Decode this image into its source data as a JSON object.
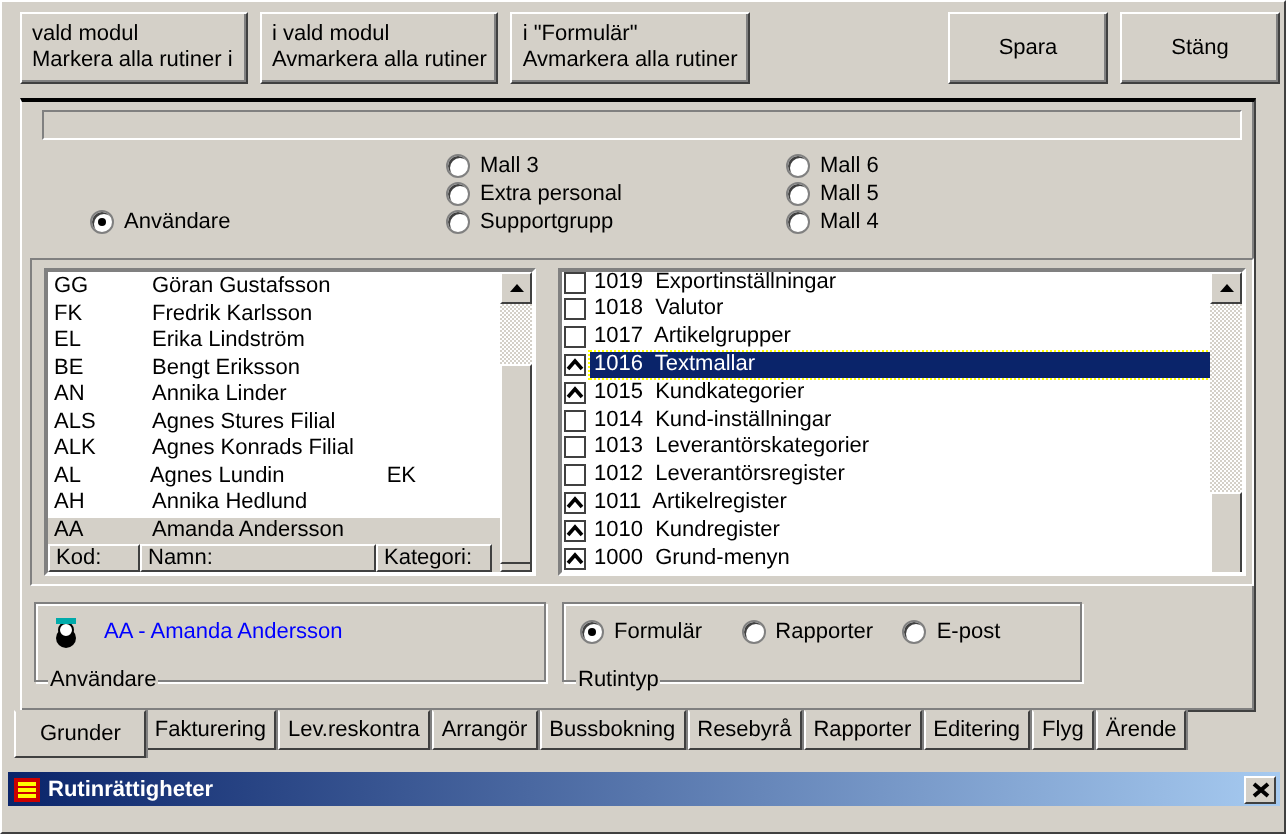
{
  "buttons": [
    {
      "lines": [
        "vald modul",
        "Markera alla rutiner i"
      ],
      "kind": "wide"
    },
    {
      "lines": [
        "i vald modul",
        "Avmarkera alla rutiner"
      ],
      "kind": "wide"
    },
    {
      "lines": [
        "i \"Formulär\"",
        "Avmarkera alla rutiner"
      ],
      "kind": "wide"
    },
    {
      "lines": [
        "Spara"
      ],
      "kind": "small"
    },
    {
      "lines": [
        "Stäng"
      ],
      "kind": "small"
    }
  ],
  "owner_options": [
    {
      "label": "Mall 3",
      "selected": false
    },
    {
      "label": "Mall 6",
      "selected": false
    },
    {
      "label": "Extra personal",
      "selected": false
    },
    {
      "label": "Mall 5",
      "selected": false
    },
    {
      "label": "Användare",
      "selected": true
    },
    {
      "label": "Supportgrupp",
      "selected": false
    },
    {
      "label": "Mall 4",
      "selected": false
    }
  ],
  "users_table": {
    "rows": [
      {
        "code": "GG",
        "name": "Göran Gustafsson",
        "selected": false
      },
      {
        "code": "FK",
        "name": "Fredrik Karlsson",
        "selected": false
      },
      {
        "code": "EL",
        "name": "Erika Lindström",
        "selected": false
      },
      {
        "code": "BE",
        "name": "Bengt Eriksson",
        "selected": false
      },
      {
        "code": "AN",
        "name": "Annika Linder",
        "selected": false
      },
      {
        "code": "ALS",
        "name": "Agnes Stures Filial",
        "selected": false
      },
      {
        "code": "ALK",
        "name": "Agnes Konrads Filial",
        "selected": false
      },
      {
        "code": "AL",
        "name": "Agnes Lundin",
        "category": "EK",
        "selected": false
      },
      {
        "code": "AH",
        "name": "Annika Hedlund",
        "selected": false
      },
      {
        "code": "AA",
        "name": "Amanda Andersson",
        "selected": true
      }
    ],
    "columns": [
      "Kod:",
      "Namn:",
      "Kategori:"
    ]
  },
  "routines": [
    {
      "code": "1019",
      "name": "Exportinställningar",
      "checked": false,
      "selected": false
    },
    {
      "code": "1018",
      "name": "Valutor",
      "checked": false,
      "selected": false
    },
    {
      "code": "1017",
      "name": "Artikelgrupper",
      "checked": false,
      "selected": false
    },
    {
      "code": "1016",
      "name": "Textmallar",
      "checked": true,
      "selected": true
    },
    {
      "code": "1015",
      "name": "Kundkategorier",
      "checked": true,
      "selected": false
    },
    {
      "code": "1014",
      "name": "Kund-inställningar",
      "checked": false,
      "selected": false
    },
    {
      "code": "1013",
      "name": "Leverantörskategorier",
      "checked": false,
      "selected": false
    },
    {
      "code": "1012",
      "name": "Leverantörsregister",
      "checked": false,
      "selected": false
    },
    {
      "code": "1011",
      "name": "Artikelregister",
      "checked": true,
      "selected": false
    },
    {
      "code": "1010",
      "name": "Kundregister",
      "checked": true,
      "selected": false
    },
    {
      "code": "1000",
      "name": "Grund-menyn",
      "checked": true,
      "selected": false
    }
  ],
  "user_group": {
    "user": "AA - Amanda Andersson",
    "legend": "Användare"
  },
  "routine_type": {
    "options": [
      {
        "label": "Formulär",
        "selected": true
      },
      {
        "label": "Rapporter",
        "selected": false
      },
      {
        "label": "E-post",
        "selected": false
      }
    ],
    "legend": "Rutintyp"
  },
  "tabs": [
    {
      "label": "Grunder",
      "selected": true
    },
    {
      "label": "Fakturering",
      "selected": false
    },
    {
      "label": "Lev.reskontra",
      "selected": false
    },
    {
      "label": "Arrangör",
      "selected": false
    },
    {
      "label": "Bussbokning",
      "selected": false
    },
    {
      "label": "Resebyrå",
      "selected": false
    },
    {
      "label": "Rapporter",
      "selected": false
    },
    {
      "label": "Editering",
      "selected": false
    },
    {
      "label": "Flyg",
      "selected": false
    },
    {
      "label": "Ärende",
      "selected": false
    }
  ],
  "window": {
    "title": "Rutinrättigheter"
  }
}
